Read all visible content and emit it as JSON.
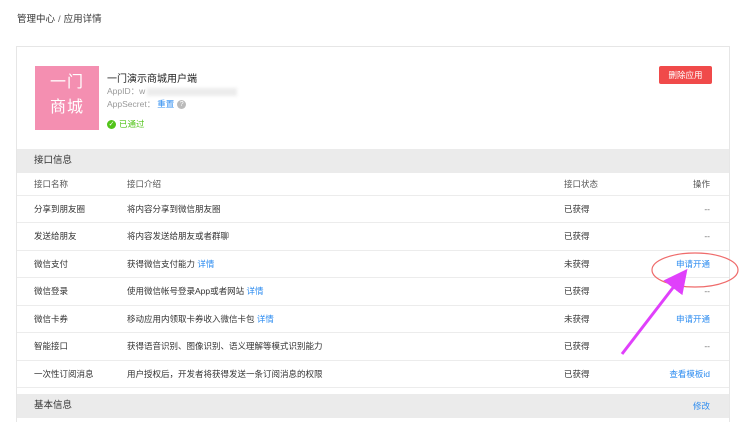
{
  "breadcrumb": {
    "root": "管理中心",
    "separator": "/",
    "current": "应用详情"
  },
  "app": {
    "logo_line1": "一门",
    "logo_line2": "商城",
    "logo_color": "#f48fb1",
    "name": "一门演示商城用户端",
    "appid_label": "AppID：w",
    "appsecret_label": "AppSecret：",
    "reset_link": "重置",
    "status": "已通过",
    "delete_button": "删除应用"
  },
  "interface_section": {
    "title": "接口信息",
    "columns": {
      "name": "接口名称",
      "desc": "接口介绍",
      "state": "接口状态",
      "action": "操作"
    },
    "rows": [
      {
        "name": "分享到朋友圈",
        "desc": "将内容分享到微信朋友圈",
        "desc_link": "",
        "state": "已获得",
        "action": "--"
      },
      {
        "name": "发送给朋友",
        "desc": "将内容发送给朋友或者群聊",
        "desc_link": "",
        "state": "已获得",
        "action": "--"
      },
      {
        "name": "微信支付",
        "desc": "获得微信支付能力",
        "desc_link": "详情",
        "state": "未获得",
        "action": "申请开通"
      },
      {
        "name": "微信登录",
        "desc": "使用微信帐号登录App或者网站",
        "desc_link": "详情",
        "state": "已获得",
        "action": "--"
      },
      {
        "name": "微信卡券",
        "desc": "移动应用内领取卡券收入微信卡包",
        "desc_link": "详情",
        "state": "未获得",
        "action": "申请开通"
      },
      {
        "name": "智能接口",
        "desc": "获得语音识别、图像识别、语义理解等模式识别能力",
        "desc_link": "",
        "state": "已获得",
        "action": "--"
      },
      {
        "name": "一次性订阅消息",
        "desc": "用户授权后，开发者将获得发送一条订阅消息的权限",
        "desc_link": "",
        "state": "已获得",
        "action": "查看模板id"
      }
    ]
  },
  "basic_section": {
    "title": "基本信息",
    "edit": "修改"
  },
  "colors": {
    "accent": "#2d8cf0",
    "danger": "#f04a4a",
    "success": "#52c41a",
    "annotation": "#e040fb"
  }
}
